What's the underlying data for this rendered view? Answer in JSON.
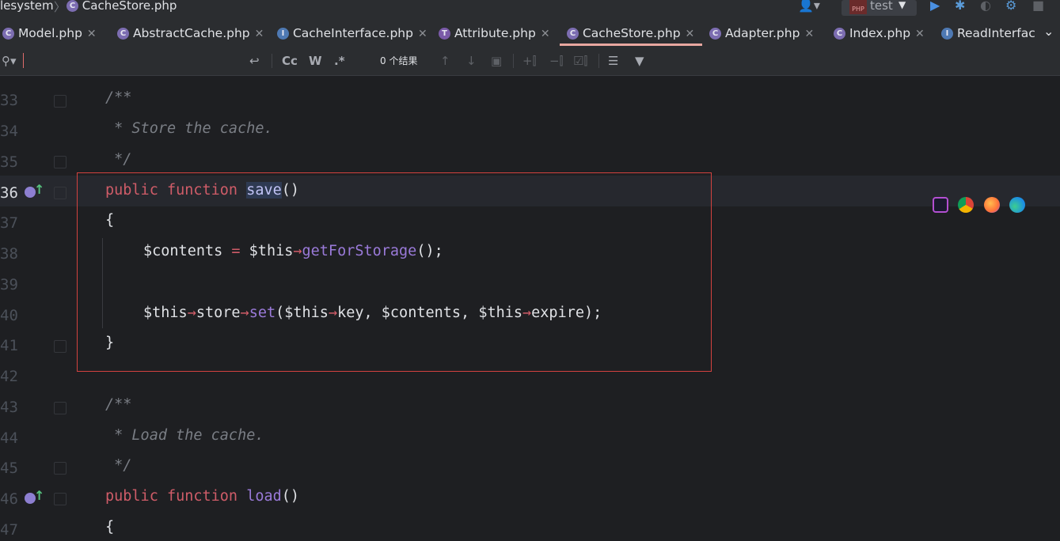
{
  "breadcrumb": {
    "items": [
      "lesystem",
      "CacheStore.php"
    ]
  },
  "toolbar": {
    "run_config": "test"
  },
  "tabs": [
    {
      "label": "Model.php",
      "icon": "class-icon"
    },
    {
      "label": "AbstractCache.php",
      "icon": "class-icon"
    },
    {
      "label": "CacheInterface.php",
      "icon": "interface-icon"
    },
    {
      "label": "Attribute.php",
      "icon": "trait-icon"
    },
    {
      "label": "CacheStore.php",
      "icon": "class-icon",
      "active": true
    },
    {
      "label": "Adapter.php",
      "icon": "class-icon"
    },
    {
      "label": "Index.php",
      "icon": "class-icon"
    },
    {
      "label": "ReadInterfac",
      "icon": "interface-icon"
    }
  ],
  "search": {
    "placeholder": "",
    "match_case": "Cc",
    "words": "W",
    "regex": ".*",
    "result_count": "0 个结果"
  },
  "editor": {
    "line_numbers": [
      "33",
      "34",
      "35",
      "36",
      "37",
      "38",
      "39",
      "40",
      "41",
      "42",
      "43",
      "44",
      "45",
      "46",
      "47"
    ],
    "lines": {
      "l33": "/**",
      "l34": " * Store the cache.",
      "l35": " */",
      "l36_kw1": "public",
      "l36_kw2": "function",
      "l36_fn": "save",
      "l36_rest": "()",
      "l37": "{",
      "l38_var": "$contents",
      "l38_eq": " = ",
      "l38_this": "$this",
      "l38_arrow": "→",
      "l38_method": "getForStorage",
      "l38_end": "();",
      "l40_this1": "$this",
      "l40_a1": "→",
      "l40_store": "store",
      "l40_a2": "→",
      "l40_set": "set",
      "l40_p1": "(",
      "l40_this2": "$this",
      "l40_a3": "→",
      "l40_key": "key, $contents, ",
      "l40_this3": "$this",
      "l40_a4": "→",
      "l40_exp": "expire);",
      "l41": "}",
      "l43": "/**",
      "l44": " * Load the cache.",
      "l45": " */",
      "l46_kw1": "public",
      "l46_kw2": "function",
      "l46_fn": "load",
      "l46_rest": "()",
      "l47": "{"
    }
  },
  "browser_icons": [
    "phpstorm-icon",
    "chrome-icon",
    "firefox-icon",
    "edge-icon"
  ],
  "colors": {
    "background": "#1e1f22",
    "keyword": "#cf5c68",
    "method": "#9a7ad9",
    "comment": "#7a7e85",
    "highlight_box": "#d3423f"
  }
}
